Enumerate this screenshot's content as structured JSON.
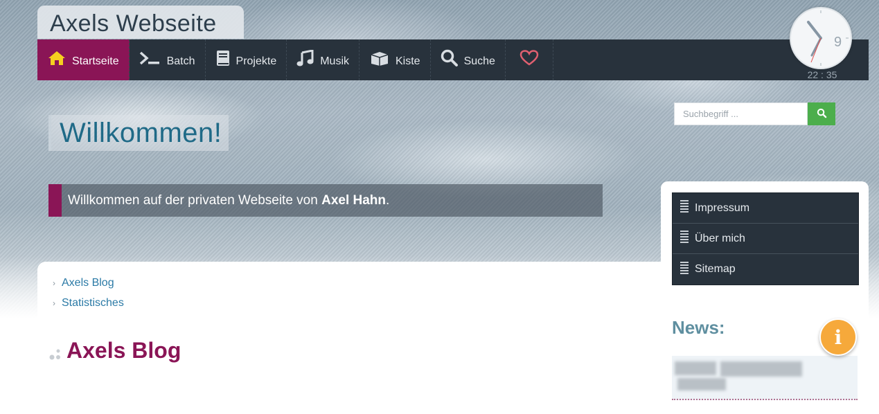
{
  "site": {
    "title": "Axels Webseite"
  },
  "nav": {
    "items": [
      {
        "label": "Startseite",
        "icon": "home-icon",
        "active": true
      },
      {
        "label": "Batch",
        "icon": "terminal-icon"
      },
      {
        "label": "Projekte",
        "icon": "book-icon"
      },
      {
        "label": "Musik",
        "icon": "music-icon"
      },
      {
        "label": "Kiste",
        "icon": "box-icon"
      },
      {
        "label": "Suche",
        "icon": "search-icon"
      },
      {
        "label": "",
        "icon": "heart-icon"
      }
    ]
  },
  "clock": {
    "number": "9",
    "time": "22 : 35"
  },
  "search": {
    "placeholder": "Suchbegriff ...",
    "button_icon": "search-icon"
  },
  "welcome": {
    "heading": "Willkommen!",
    "intro_prefix": "Willkommen auf der privaten Webseite von ",
    "intro_name": "Axel Hahn",
    "intro_suffix": "."
  },
  "subnav": {
    "items": [
      "Axels Blog",
      "Statistisches"
    ]
  },
  "main": {
    "heading": "Axels Blog"
  },
  "sidebar": {
    "menu": [
      "Impressum",
      "Über mich",
      "Sitemap"
    ],
    "news_title": "News:"
  },
  "info_button": {
    "label": "i"
  },
  "colors": {
    "accent": "#8a1556",
    "nav_bg": "#28323c",
    "link": "#2b7aa6",
    "heading": "#1f6a87",
    "search_button": "#4cae4c",
    "info": "#f6a93b"
  }
}
